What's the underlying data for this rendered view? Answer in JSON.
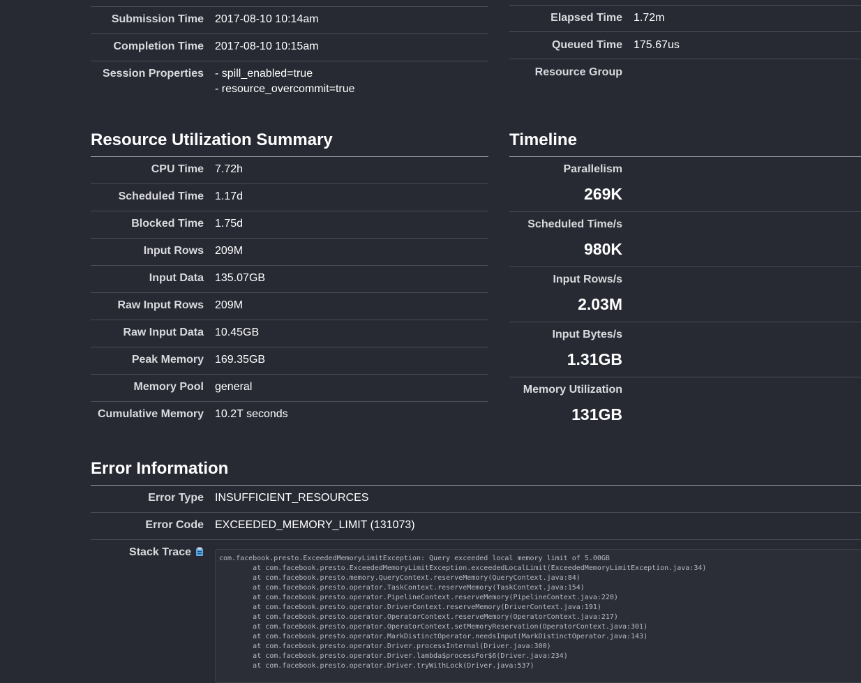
{
  "session": {
    "submission_time": {
      "label": "Submission Time",
      "value": "2017-08-10 10:14am"
    },
    "completion_time": {
      "label": "Completion Time",
      "value": "2017-08-10 10:15am"
    },
    "session_properties": {
      "label": "Session Properties",
      "values": [
        "- spill_enabled=true",
        "- resource_overcommit=true"
      ]
    },
    "elapsed_time": {
      "label": "Elapsed Time",
      "value": "1.72m"
    },
    "queued_time": {
      "label": "Queued Time",
      "value": "175.67us"
    },
    "resource_group": {
      "label": "Resource Group",
      "value": ""
    }
  },
  "resource_summary": {
    "title": "Resource Utilization Summary",
    "rows": [
      {
        "label": "CPU Time",
        "value": "7.72h"
      },
      {
        "label": "Scheduled Time",
        "value": "1.17d"
      },
      {
        "label": "Blocked Time",
        "value": "1.75d"
      },
      {
        "label": "Input Rows",
        "value": "209M"
      },
      {
        "label": "Input Data",
        "value": "135.07GB"
      },
      {
        "label": "Raw Input Rows",
        "value": "209M"
      },
      {
        "label": "Raw Input Data",
        "value": "10.45GB"
      },
      {
        "label": "Peak Memory",
        "value": "169.35GB"
      },
      {
        "label": "Memory Pool",
        "value": "general"
      },
      {
        "label": "Cumulative Memory",
        "value": "10.2T seconds"
      }
    ]
  },
  "timeline": {
    "title": "Timeline",
    "rows": [
      {
        "label": "Parallelism",
        "value": "269K"
      },
      {
        "label": "Scheduled Time/s",
        "value": "980K"
      },
      {
        "label": "Input Rows/s",
        "value": "2.03M"
      },
      {
        "label": "Input Bytes/s",
        "value": "1.31GB"
      },
      {
        "label": "Memory Utilization",
        "value": "131GB"
      }
    ]
  },
  "error": {
    "title": "Error Information",
    "error_type": {
      "label": "Error Type",
      "value": "INSUFFICIENT_RESOURCES"
    },
    "error_code": {
      "label": "Error Code",
      "value": "EXCEEDED_MEMORY_LIMIT (131073)"
    },
    "stack_trace": {
      "label": "Stack Trace",
      "copy_icon": "clipboard-icon",
      "text": "com.facebook.presto.ExceededMemoryLimitException: Query exceeded local memory limit of 5.00GB\n\tat com.facebook.presto.ExceededMemoryLimitException.exceededLocalLimit(ExceededMemoryLimitException.java:34)\n\tat com.facebook.presto.memory.QueryContext.reserveMemory(QueryContext.java:84)\n\tat com.facebook.presto.operator.TaskContext.reserveMemory(TaskContext.java:154)\n\tat com.facebook.presto.operator.PipelineContext.reserveMemory(PipelineContext.java:220)\n\tat com.facebook.presto.operator.DriverContext.reserveMemory(DriverContext.java:191)\n\tat com.facebook.presto.operator.OperatorContext.reserveMemory(OperatorContext.java:217)\n\tat com.facebook.presto.operator.OperatorContext.setMemoryReservation(OperatorContext.java:301)\n\tat com.facebook.presto.operator.MarkDistinctOperator.needsInput(MarkDistinctOperator.java:143)\n\tat com.facebook.presto.operator.Driver.processInternal(Driver.java:300)\n\tat com.facebook.presto.operator.Driver.lambda$processFor$6(Driver.java:234)\n\tat com.facebook.presto.operator.Driver.tryWithLock(Driver.java:537)"
    }
  }
}
